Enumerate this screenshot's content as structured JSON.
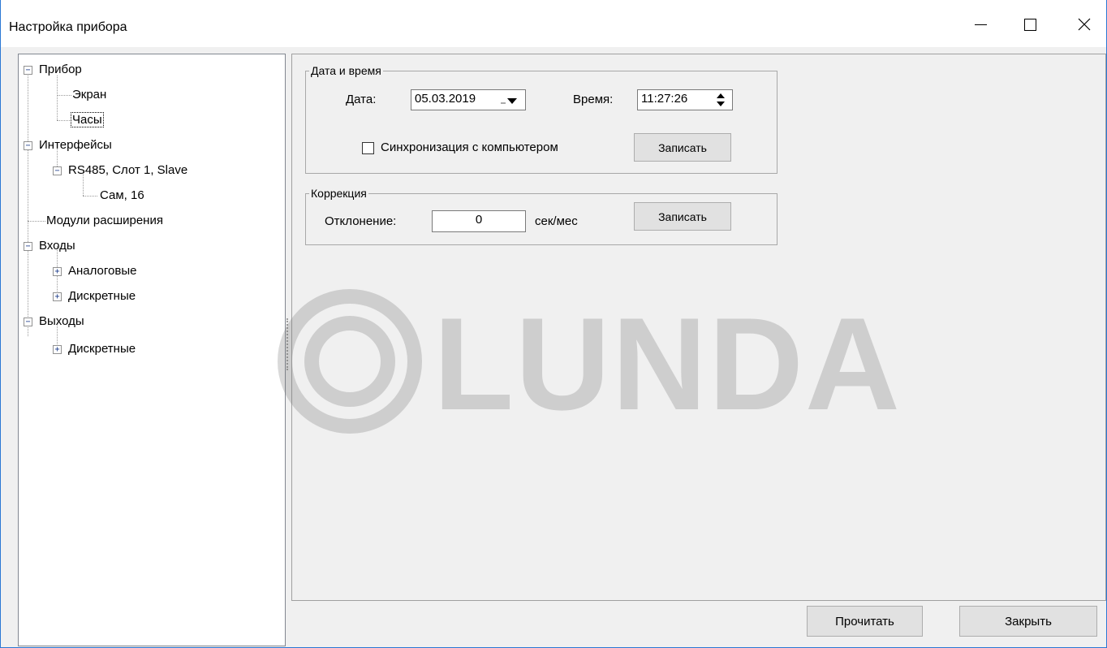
{
  "window": {
    "title": "Настройка прибора",
    "controls": {
      "minimize": "minimize-icon",
      "maximize": "maximize-icon",
      "close": "close-icon"
    }
  },
  "tree": {
    "items": [
      {
        "label": "Прибор",
        "level": 0,
        "expanded": true
      },
      {
        "label": "Экран",
        "level": 1
      },
      {
        "label": "Часы",
        "level": 1,
        "selected": true
      },
      {
        "label": "Интерфейсы",
        "level": 0,
        "expanded": true
      },
      {
        "label": "RS485, Слот 1, Slave",
        "level": 1,
        "expanded": true
      },
      {
        "label": "Сам, 16",
        "level": 2
      },
      {
        "label": "Модули расширения",
        "level": 0
      },
      {
        "label": "Входы",
        "level": 0,
        "expanded": true
      },
      {
        "label": "Аналоговые",
        "level": 1,
        "expanded": false
      },
      {
        "label": "Дискретные",
        "level": 1,
        "expanded": false
      },
      {
        "label": "Выходы",
        "level": 0,
        "expanded": true
      },
      {
        "label": "Дискретные",
        "level": 1,
        "expanded": false
      }
    ]
  },
  "datetime_group": {
    "legend": "Дата и время",
    "date_label": "Дата:",
    "date_value": "05.03.2019",
    "time_label": "Время:",
    "time_value": "11:27:26",
    "sync_label": "Синхронизация с компьютером",
    "sync_checked": false,
    "write_button": "Записать"
  },
  "correction_group": {
    "legend": "Коррекция",
    "deviation_label": "Отклонение:",
    "deviation_value": "0",
    "unit": "сек/мес",
    "write_button": "Записать"
  },
  "footer": {
    "read_button": "Прочитать",
    "close_button": "Закрыть"
  },
  "watermark": {
    "text": "LUNDA"
  }
}
